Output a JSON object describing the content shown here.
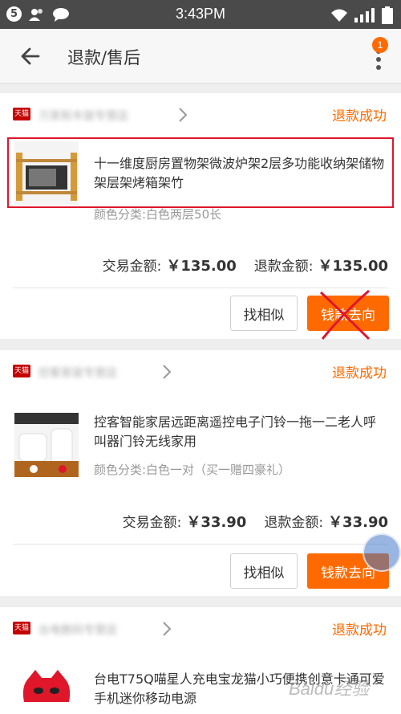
{
  "status_bar": {
    "notification_count": "5",
    "time": "3:43PM"
  },
  "app_bar": {
    "title": "退款/售后",
    "menu_badge": "1"
  },
  "orders": [
    {
      "shop_badge": "天猫",
      "store_name": "万家和丰居专营店",
      "status": "退款成功",
      "product_name": "十一维度厨房置物架微波炉架2层多功能收纳架储物架层架烤箱架竹",
      "sku": "颜色分类:白色两层50长",
      "trade_label": "交易金额:",
      "trade_amount": "￥135.00",
      "refund_label": "退款金额:",
      "refund_amount": "￥135.00",
      "btn_similar": "找相似",
      "btn_money": "钱款去向"
    },
    {
      "shop_badge": "天猫",
      "store_name": "控客家居专营店",
      "status": "退款成功",
      "product_name": "控客智能家居远距离遥控电子门铃一拖一二老人呼叫器门铃无线家用",
      "sku": "颜色分类:白色一对（买一赠四豪礼）",
      "trade_label": "交易金额:",
      "trade_amount": "￥33.90",
      "refund_label": "退款金额:",
      "refund_amount": "￥33.90",
      "btn_similar": "找相似",
      "btn_money": "钱款去向"
    },
    {
      "shop_badge": "天猫",
      "store_name": "台电数码专营店",
      "status": "退款成功",
      "product_name": "台电T75Q喵星人充电宝龙猫小巧便携创意卡通可爱手机迷你移动电源"
    }
  ],
  "watermark": "Baidu经验",
  "colors": {
    "accent": "#ff6a00",
    "highlight": "#e0162b",
    "tmall": "#c40000"
  }
}
